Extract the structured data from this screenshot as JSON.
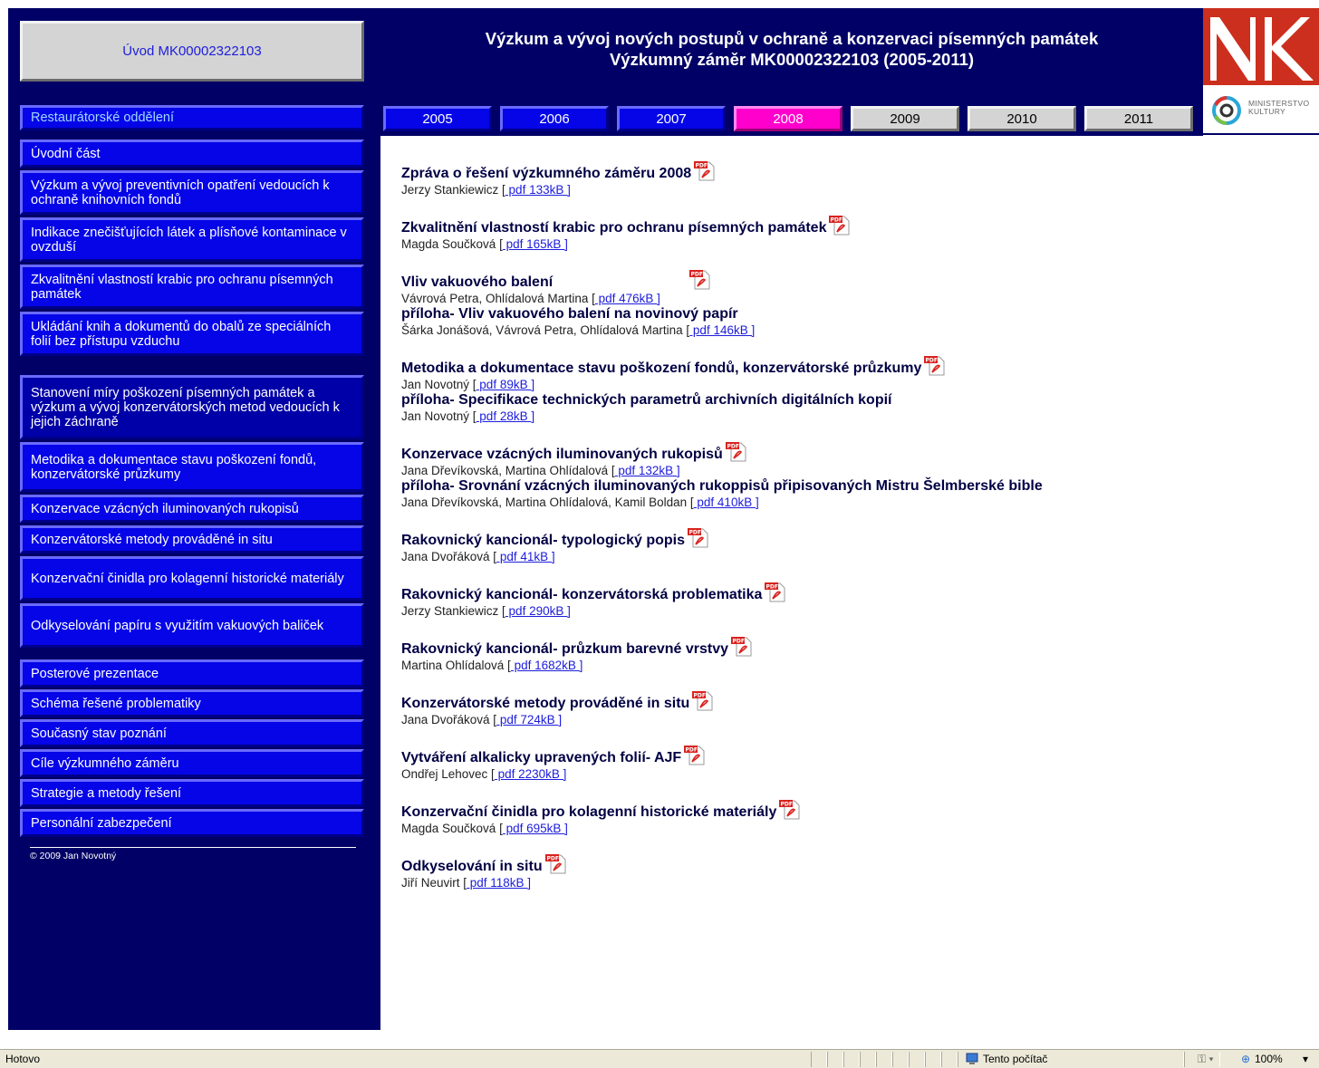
{
  "sidebar": {
    "intro_button": "Úvod MK00002322103",
    "section_head": "Restaurátorské oddělení",
    "group1": [
      "Úvodní část",
      "Výzkum a vývoj preventivních opatření vedoucích k ochraně knihovních fondů",
      "Indikace znečišťujících látek a plísňové kontaminace v ovzduší",
      "Zkvalitnění vlastností krabic pro ochranu písemných památek",
      "Ukládání knih a dokumentů do obalů ze speciálních folií bez přístupu vzduchu"
    ],
    "group2": [
      "Stanovení míry poškození písemných památek a výzkum a vývoj konzervátorských metod vedoucích k jejich záchraně",
      "Metodika a dokumentace stavu poškození fondů, konzervátorské průzkumy",
      "Konzervace vzácných iluminovaných rukopisů",
      "Konzervátorské metody prováděné in situ",
      "Konzervační činidla pro kolagenní historické materiály",
      "Odkyselování papíru s využitím vakuových baliček"
    ],
    "group3": [
      "Posterové prezentace",
      "Schéma řešené problematiky",
      "Současný stav poznání",
      "Cíle výzkumného záměru",
      "Strategie a metody řešení",
      "Personální zabezpečení"
    ],
    "copyright": "© 2009 Jan Novotný"
  },
  "header": {
    "title_line1": "Výzkum a vývoj nových postupů v ochraně a konzervaci písemných památek",
    "title_line2": "Výzkumný záměr MK00002322103 (2005-2011)",
    "years": [
      "2005",
      "2006",
      "2007",
      "2008",
      "2009",
      "2010",
      "2011"
    ],
    "active_year": "2008"
  },
  "logos": {
    "nk_letters": "NK",
    "mk_line1": "MINISTERSTVO",
    "mk_line2": "KULTURY"
  },
  "entries": [
    {
      "title": "Zpráva o řešení výzkumného záměru 2008",
      "author": "Jerzy Stankiewicz [",
      "link": " pdf 133kB ]"
    },
    {
      "title": "Zkvalitnění vlastností krabic pro ochranu písemných památek",
      "author": "Magda Součková [",
      "link": " pdf 165kB ]"
    },
    {
      "title": "Vliv vakuového balení",
      "author": "Vávrová Petra, Ohlídalová Martina [",
      "link": " pdf 476kB ]",
      "sub_title": "příloha- Vliv vakuového balení na novinový papír",
      "sub_author": "Šárka Jonášová, Vávrová Petra, Ohlídalová Martina [",
      "sub_link": " pdf 146kB ]"
    },
    {
      "title": "Metodika a dokumentace stavu poškození fondů, konzervátorské průzkumy",
      "author": "Jan Novotný [",
      "link": " pdf 89kB ]",
      "sub_title": "příloha- Specifikace technických parametrů archivních digitálních kopií",
      "sub_author": "Jan Novotný [",
      "sub_link": " pdf 28kB ]"
    },
    {
      "title": "Konzervace vzácných iluminovaných rukopisů",
      "author": "Jana Dřevíkovská, Martina Ohlídalová [",
      "link": " pdf 132kB ]",
      "sub_title": "příloha- Srovnání vzácných iluminovaných rukoppisů připisovaných Mistru Šelmberské bible",
      "sub_author": "Jana Dřevíkovská, Martina Ohlídalová, Kamil Boldan [",
      "sub_link": " pdf 410kB ]"
    },
    {
      "title": "Rakovnický kancionál- typologický popis",
      "author": "Jana Dvořáková [",
      "link": " pdf 41kB ]"
    },
    {
      "title": "Rakovnický kancionál- konzervátorská problematika",
      "author": "Jerzy Stankiewicz [",
      "link": " pdf 290kB ]"
    },
    {
      "title": "Rakovnický kancionál- průzkum barevné vrstvy",
      "author": "Martina Ohlídalová [",
      "link": " pdf 1682kB ]"
    },
    {
      "title": "Konzervátorské metody prováděné in situ",
      "author": "Jana Dvořáková [",
      "link": " pdf 724kB ]"
    },
    {
      "title": "Vytváření alkalicky upravených folií- AJF",
      "author": "Ondřej Lehovec [",
      "link": " pdf 2230kB ]"
    },
    {
      "title": "Konzervační činidla pro kolagenní historické materiály",
      "author": "Magda Součková [",
      "link": " pdf 695kB ]"
    },
    {
      "title": "Odkyselování in situ",
      "author": "Jiří Neuvirt [",
      "link": " pdf 118kB ]"
    }
  ],
  "statusbar": {
    "status": "Hotovo",
    "zone": "Tento počítač",
    "zoom": "100%"
  },
  "colors": {
    "navy": "#000066",
    "nav_blue": "#0505e8",
    "active_pink": "#ff00cc",
    "nk_red": "#cc2f1d"
  }
}
